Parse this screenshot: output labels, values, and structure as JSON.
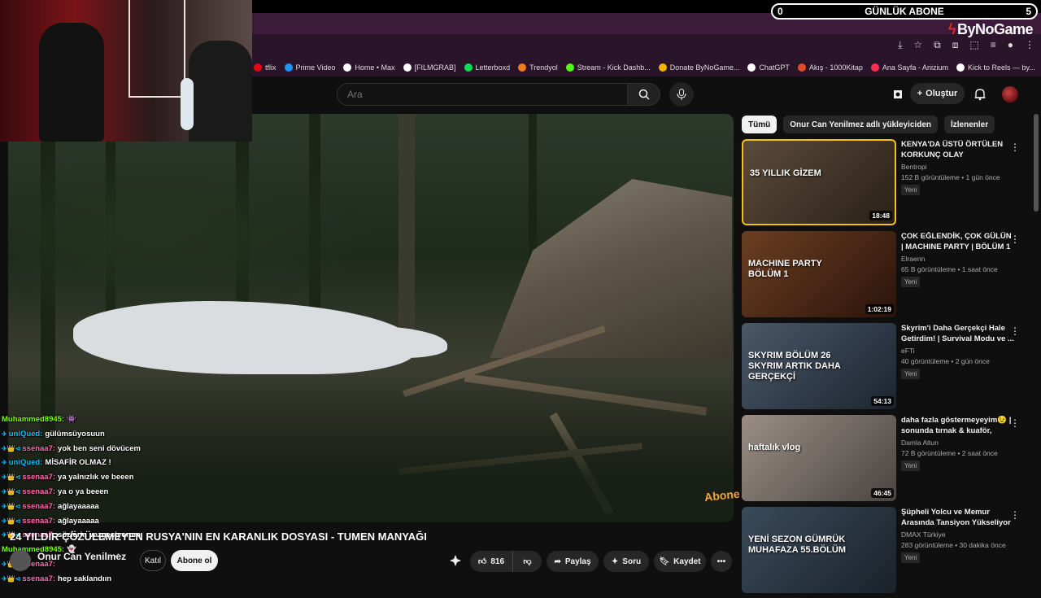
{
  "overlay": {
    "abone_left": "0",
    "abone_title": "GÜNLÜK ABONE",
    "abone_right": "5",
    "brand": "ByNoGame"
  },
  "bookmarks": [
    {
      "label": "tflix",
      "color": "#e50914"
    },
    {
      "label": "Prime Video",
      "color": "#1a98ff"
    },
    {
      "label": "Home • Max",
      "color": "#ffffff"
    },
    {
      "label": "[FILMGRAB]",
      "color": "#ffffff"
    },
    {
      "label": "Letterboxd",
      "color": "#00e054"
    },
    {
      "label": "Trendyol",
      "color": "#f27a1a"
    },
    {
      "label": "Stream - Kick Dashb...",
      "color": "#53fc18"
    },
    {
      "label": "Donate ByNoGame...",
      "color": "#f4b400"
    },
    {
      "label": "ChatGPT",
      "color": "#ffffff"
    },
    {
      "label": "Akış - 1000Kitap",
      "color": "#e34c26"
    },
    {
      "label": "Ana Sayfa - Anizium",
      "color": "#ff2d55"
    },
    {
      "label": "Kick to Reels — by...",
      "color": "#ffffff"
    }
  ],
  "header": {
    "search_placeholder": "Ara",
    "create_label": "Oluştur"
  },
  "video": {
    "title": "24 YILDIR ÇÖZÜLEMEYEN RUSYA'NIN EN KARANLIK DOSYASI - TUMEN MANYAĞI",
    "channel": "Onur Can Yenilmez",
    "join_label": "Katıl",
    "subscribe_label": "Abone ol",
    "likes": "816",
    "share_label": "Paylaş",
    "ask_label": "Soru",
    "save_label": "Kaydet",
    "abone_watermark": "Abone ol"
  },
  "chat": [
    {
      "user": "Muhammed8945:",
      "msg": "👾",
      "color": "#7cfc00",
      "badges": ""
    },
    {
      "user": "uniQued:",
      "msg": "gülümsüyosuun",
      "color": "#00bfff",
      "badges": "✈"
    },
    {
      "user": "ssenaa7:",
      "msg": "yok ben seni dövücem",
      "color": "#ff69b4",
      "badges": "✈👑⊲"
    },
    {
      "user": "uniQued:",
      "msg": "MİSAFİR OLMAZ !",
      "color": "#00bfff",
      "badges": "✈"
    },
    {
      "user": "ssenaa7:",
      "msg": "ya yalnızlık ve beeen",
      "color": "#ff69b4",
      "badges": "✈👑⊲"
    },
    {
      "user": "ssenaa7:",
      "msg": "ya o ya beeen",
      "color": "#ff69b4",
      "badges": "✈👑⊲"
    },
    {
      "user": "ssenaa7:",
      "msg": "ağlayaaaaa",
      "color": "#ff69b4",
      "badges": "✈👑⊲"
    },
    {
      "user": "ssenaa7:",
      "msg": "ağlayaaaaa",
      "color": "#ff69b4",
      "badges": "✈👑⊲"
    },
    {
      "user": "ssenaa7:",
      "msg": "sözlerin vazgeçiyorum",
      "color": "#ff69b4",
      "badges": "✈👑⊲"
    },
    {
      "user": "Muhammed8945:",
      "msg": "👻",
      "color": "#7cfc00",
      "badges": ""
    },
    {
      "user": "ssenaa7:",
      "msg": "",
      "color": "#ff69b4",
      "badges": "✈👑⊲"
    },
    {
      "user": "ssenaa7:",
      "msg": "hep saklandıın",
      "color": "#ff69b4",
      "badges": "✈👑⊲"
    }
  ],
  "chips": [
    {
      "label": "Tümü",
      "active": true
    },
    {
      "label": "Onur Can Yenilmez adlı yükleyiciden",
      "active": false
    },
    {
      "label": "İzlenenler",
      "active": false
    }
  ],
  "recommendations": [
    {
      "title": "KENYA'DA ÜSTÜ ÖRTÜLEN KORKUNÇ OLAY",
      "channel": "Bentropi",
      "meta": "152 B görüntüleme • 1 gün önce",
      "badge": "Yeni",
      "duration": "18:48",
      "thumb_text": "35 YILLIK GİZEM",
      "colors": [
        "#5a4a3a",
        "#2a2018"
      ],
      "highlight": "#f4c20d"
    },
    {
      "title": "ÇOK EĞLENDİK, ÇOK GÜLÜN | MACHINE PARTY | BÖLÜM 1",
      "channel": "Elraenn",
      "meta": "65 B görüntüleme • 1 saat önce",
      "badge": "Yeni",
      "duration": "1:02:19",
      "thumb_text": "MACHINE PARTY BÖLÜM 1",
      "colors": [
        "#6b3e22",
        "#2a140a"
      ],
      "highlight": ""
    },
    {
      "title": "Skyrim'i Daha Gerçekçi Hale Getirdim! | Survival Modu ve ...",
      "channel": "eFTi",
      "meta": "40 görüntüleme • 2 gün önce",
      "badge": "Yeni",
      "duration": "54:13",
      "thumb_text": "SKYRIM BÖLÜM 26 SKYRIM ARTIK DAHA GERÇEKÇİ",
      "colors": [
        "#4a5868",
        "#1c2430"
      ],
      "highlight": ""
    },
    {
      "title": "daha fazla göstermeyeyim😉 | sonunda tırnak & kuaför, ege'ni...",
      "channel": "Damla Altun",
      "meta": "72 B görüntüleme • 2 saat önce",
      "badge": "Yeni",
      "duration": "46:45",
      "thumb_text": "haftalık vlog",
      "colors": [
        "#9a8e86",
        "#4a4440"
      ],
      "highlight": ""
    },
    {
      "title": "Şüpheli Yolcu ve Memur Arasında Tansiyon Yükseliyor | ...",
      "channel": "DMAX Türkiye",
      "meta": "283 görüntüleme • 30 dakika önce",
      "badge": "Yeni",
      "duration": "",
      "thumb_text": "YENİ SEZON GÜMRÜK MUHAFAZA 55.BÖLÜM",
      "colors": [
        "#3a4a5a",
        "#1a222a"
      ],
      "highlight": ""
    }
  ]
}
